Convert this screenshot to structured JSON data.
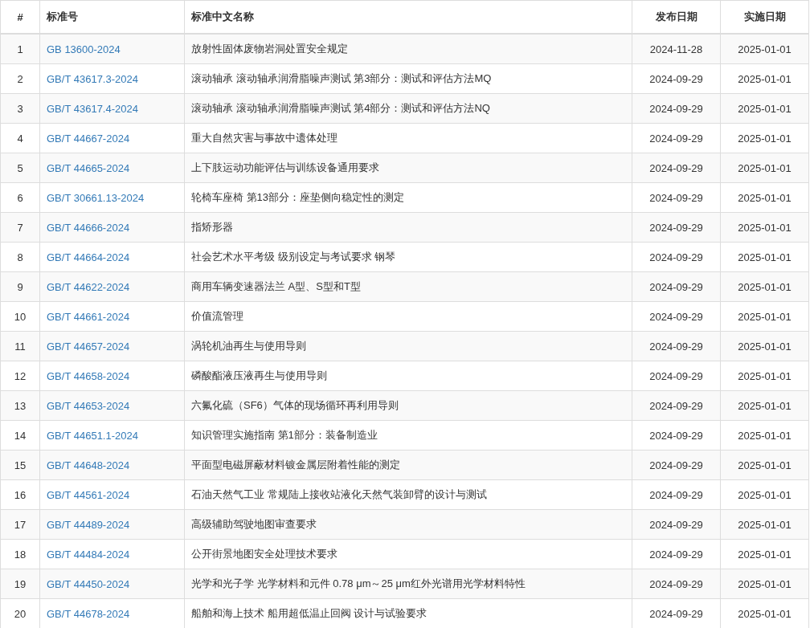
{
  "table": {
    "columns": [
      "#",
      "标准号",
      "标准中文名称",
      "发布日期",
      "实施日期"
    ],
    "rows": [
      {
        "no": "1",
        "code": "GB 13600-2024",
        "name": "放射性固体废物岩洞处置安全规定",
        "published": "2024-11-28",
        "effective": "2025-01-01"
      },
      {
        "no": "2",
        "code": "GB/T 43617.3-2024",
        "name": "滚动轴承 滚动轴承润滑脂噪声测试 第3部分：测试和评估方法MQ",
        "published": "2024-09-29",
        "effective": "2025-01-01"
      },
      {
        "no": "3",
        "code": "GB/T 43617.4-2024",
        "name": "滚动轴承 滚动轴承润滑脂噪声测试 第4部分：测试和评估方法NQ",
        "published": "2024-09-29",
        "effective": "2025-01-01"
      },
      {
        "no": "4",
        "code": "GB/T 44667-2024",
        "name": "重大自然灾害与事故中遗体处理",
        "published": "2024-09-29",
        "effective": "2025-01-01"
      },
      {
        "no": "5",
        "code": "GB/T 44665-2024",
        "name": "上下肢运动功能评估与训练设备通用要求",
        "published": "2024-09-29",
        "effective": "2025-01-01"
      },
      {
        "no": "6",
        "code": "GB/T 30661.13-2024",
        "name": "轮椅车座椅 第13部分：座垫侧向稳定性的测定",
        "published": "2024-09-29",
        "effective": "2025-01-01"
      },
      {
        "no": "7",
        "code": "GB/T 44666-2024",
        "name": "指矫形器",
        "published": "2024-09-29",
        "effective": "2025-01-01"
      },
      {
        "no": "8",
        "code": "GB/T 44664-2024",
        "name": "社会艺术水平考级 级别设定与考试要求 钢琴",
        "published": "2024-09-29",
        "effective": "2025-01-01"
      },
      {
        "no": "9",
        "code": "GB/T 44622-2024",
        "name": "商用车辆变速器法兰 A型、S型和T型",
        "published": "2024-09-29",
        "effective": "2025-01-01"
      },
      {
        "no": "10",
        "code": "GB/T 44661-2024",
        "name": "价值流管理",
        "published": "2024-09-29",
        "effective": "2025-01-01"
      },
      {
        "no": "11",
        "code": "GB/T 44657-2024",
        "name": "涡轮机油再生与使用导则",
        "published": "2024-09-29",
        "effective": "2025-01-01"
      },
      {
        "no": "12",
        "code": "GB/T 44658-2024",
        "name": "磷酸酯液压液再生与使用导则",
        "published": "2024-09-29",
        "effective": "2025-01-01"
      },
      {
        "no": "13",
        "code": "GB/T 44653-2024",
        "name": "六氟化硫（SF6）气体的现场循环再利用导则",
        "published": "2024-09-29",
        "effective": "2025-01-01"
      },
      {
        "no": "14",
        "code": "GB/T 44651.1-2024",
        "name": "知识管理实施指南 第1部分：装备制造业",
        "published": "2024-09-29",
        "effective": "2025-01-01"
      },
      {
        "no": "15",
        "code": "GB/T 44648-2024",
        "name": "平面型电磁屏蔽材料镀金属层附着性能的测定",
        "published": "2024-09-29",
        "effective": "2025-01-01"
      },
      {
        "no": "16",
        "code": "GB/T 44561-2024",
        "name": "石油天然气工业 常规陆上接收站液化天然气装卸臂的设计与测试",
        "published": "2024-09-29",
        "effective": "2025-01-01"
      },
      {
        "no": "17",
        "code": "GB/T 44489-2024",
        "name": "高级辅助驾驶地图审查要求",
        "published": "2024-09-29",
        "effective": "2025-01-01"
      },
      {
        "no": "18",
        "code": "GB/T 44484-2024",
        "name": "公开街景地图安全处理技术要求",
        "published": "2024-09-29",
        "effective": "2025-01-01"
      },
      {
        "no": "19",
        "code": "GB/T 44450-2024",
        "name": "光学和光子学 光学材料和元件 0.78 μm～25 μm红外光谱用光学材料特性",
        "published": "2024-09-29",
        "effective": "2025-01-01"
      },
      {
        "no": "20",
        "code": "GB/T 44678-2024",
        "name": "船舶和海上技术 船用超低温止回阀 设计与试验要求",
        "published": "2024-09-29",
        "effective": "2025-01-01"
      }
    ]
  }
}
